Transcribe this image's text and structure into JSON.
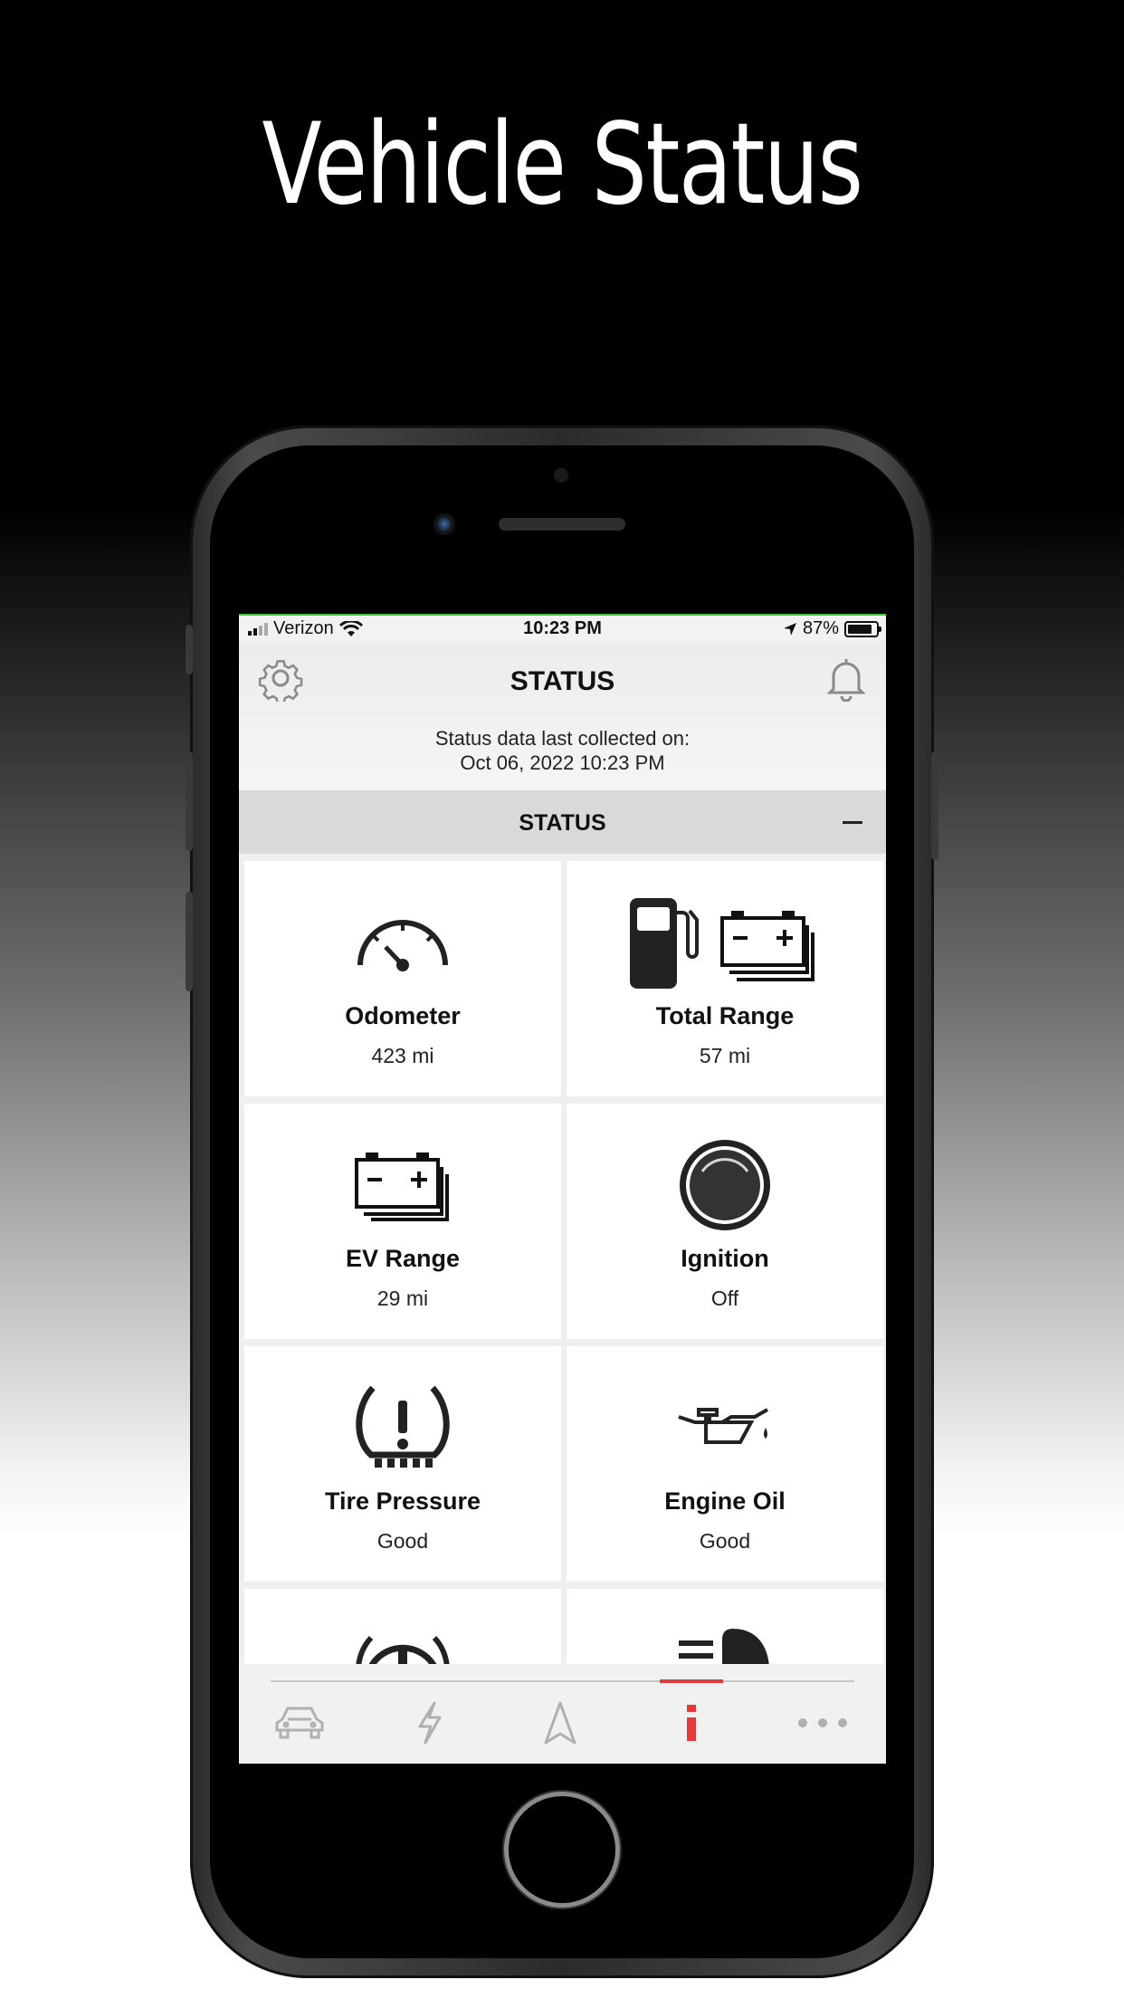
{
  "headline": "Vehicle Status",
  "status_bar": {
    "carrier": "Verizon",
    "time": "10:23 PM",
    "battery": "87%",
    "battery_level": 0.87
  },
  "header": {
    "title": "STATUS",
    "collected_line1": "Status data last collected on:",
    "collected_line2": "Oct 06, 2022 10:23 PM"
  },
  "section": {
    "title": "STATUS"
  },
  "tiles": [
    {
      "label": "Odometer",
      "value": "423 mi",
      "icon": "speedometer-icon"
    },
    {
      "label": "Total Range",
      "value": "57 mi",
      "icon": "fuel-battery-icon"
    },
    {
      "label": "EV Range",
      "value": "29 mi",
      "icon": "battery-icon"
    },
    {
      "label": "Ignition",
      "value": "Off",
      "icon": "ignition-icon"
    },
    {
      "label": "Tire Pressure",
      "value": "Good",
      "icon": "tire-pressure-icon"
    },
    {
      "label": "Engine Oil",
      "value": "Good",
      "icon": "oil-can-icon"
    },
    {
      "label": "",
      "value": "",
      "icon": "brake-warning-icon"
    },
    {
      "label": "",
      "value": "",
      "icon": "headlight-icon"
    }
  ],
  "tabs": [
    {
      "name": "vehicle",
      "icon": "car-icon",
      "active": false
    },
    {
      "name": "charge",
      "icon": "lightning-icon",
      "active": false
    },
    {
      "name": "navigation",
      "icon": "navigation-arrow-icon",
      "active": false
    },
    {
      "name": "info",
      "icon": "info-icon",
      "active": true
    },
    {
      "name": "more",
      "icon": "more-dots-icon",
      "active": false
    }
  ],
  "colors": {
    "accent": "#e23b3b",
    "status_bar_line": "#3ecf3e"
  }
}
